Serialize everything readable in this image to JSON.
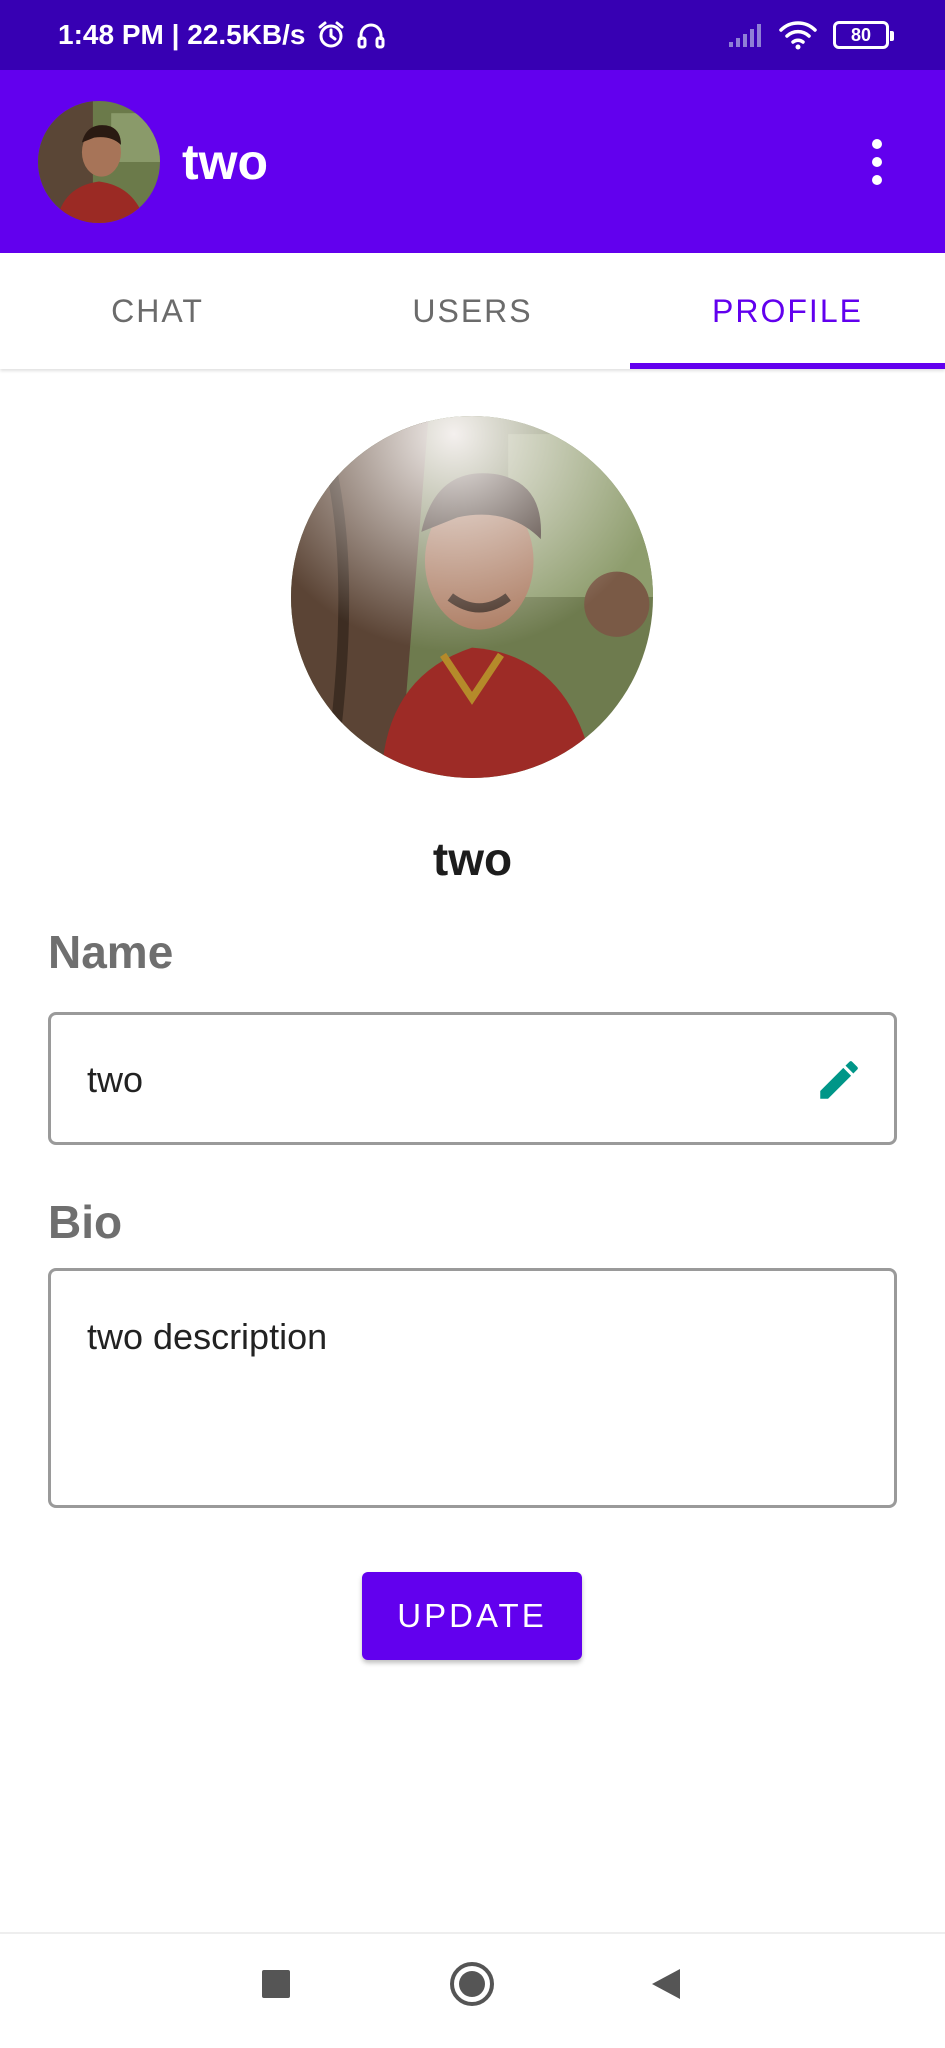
{
  "status_bar": {
    "time_speed": "1:48 PM | 22.5KB/s",
    "battery": "80",
    "icons": [
      "alarm-icon",
      "headset-icon",
      "signal-icon",
      "wifi-icon",
      "battery-icon"
    ]
  },
  "app_bar": {
    "title": "two",
    "avatar": "user-avatar",
    "menu_icon": "more-vert-icon"
  },
  "tabs": [
    {
      "label": "CHAT",
      "active": false
    },
    {
      "label": "USERS",
      "active": false
    },
    {
      "label": "PROFILE",
      "active": true
    }
  ],
  "profile": {
    "display_name": "two",
    "name_label": "Name",
    "name_value": "two",
    "bio_label": "Bio",
    "bio_value": "two description",
    "update_label": "UPDATE"
  },
  "nav_bar": {
    "icons": [
      "recents-square-icon",
      "home-circle-icon",
      "back-triangle-icon"
    ]
  },
  "colors": {
    "primary": "#6200EE",
    "primary_dark": "#3700B3",
    "edit_icon": "#009688"
  }
}
